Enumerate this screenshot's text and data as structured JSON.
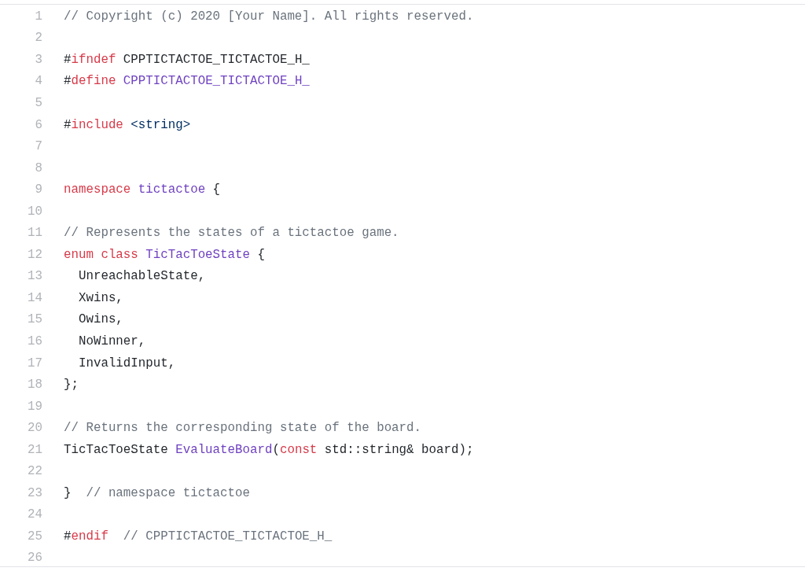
{
  "lines": [
    {
      "number": "1",
      "tokens": [
        {
          "text": "// Copyright (c) 2020 [Your Name]. All rights reserved.",
          "kind": "comment"
        }
      ]
    },
    {
      "number": "2"
    },
    {
      "number": "3",
      "tokens": [
        {
          "text": "#",
          "kind": "plain"
        },
        {
          "text": "ifndef",
          "kind": "keyword"
        },
        {
          "text": " CPPTICTACTOE_TICTACTOE_H_",
          "kind": "plain"
        }
      ]
    },
    {
      "number": "4",
      "tokens": [
        {
          "text": "#",
          "kind": "plain"
        },
        {
          "text": "define",
          "kind": "keyword"
        },
        {
          "text": " CPPTICTACTOE_TICTACTOE_H_",
          "kind": "entity"
        }
      ]
    },
    {
      "number": "5"
    },
    {
      "number": "6",
      "tokens": [
        {
          "text": "#",
          "kind": "plain"
        },
        {
          "text": "include",
          "kind": "keyword"
        },
        {
          "text": " <string>",
          "kind": "string"
        }
      ]
    },
    {
      "number": "7"
    },
    {
      "number": "8"
    },
    {
      "number": "9",
      "tokens": [
        {
          "text": "namespace",
          "kind": "keyword"
        },
        {
          "text": " tictactoe",
          "kind": "entity"
        },
        {
          "text": " {",
          "kind": "plain"
        }
      ]
    },
    {
      "number": "10"
    },
    {
      "number": "11",
      "tokens": [
        {
          "text": "// Represents the states of a tictactoe game.",
          "kind": "comment"
        }
      ]
    },
    {
      "number": "12",
      "tokens": [
        {
          "text": "enum class",
          "kind": "keyword"
        },
        {
          "text": " TicTacToeState",
          "kind": "entity"
        },
        {
          "text": " {",
          "kind": "plain"
        }
      ]
    },
    {
      "number": "13",
      "tokens": [
        {
          "text": "  UnreachableState,",
          "kind": "plain"
        }
      ]
    },
    {
      "number": "14",
      "tokens": [
        {
          "text": "  Xwins,",
          "kind": "plain"
        }
      ]
    },
    {
      "number": "15",
      "tokens": [
        {
          "text": "  Owins,",
          "kind": "plain"
        }
      ]
    },
    {
      "number": "16",
      "tokens": [
        {
          "text": "  NoWinner,",
          "kind": "plain"
        }
      ]
    },
    {
      "number": "17",
      "tokens": [
        {
          "text": "  InvalidInput,",
          "kind": "plain"
        }
      ]
    },
    {
      "number": "18",
      "tokens": [
        {
          "text": "};",
          "kind": "plain"
        }
      ]
    },
    {
      "number": "19"
    },
    {
      "number": "20",
      "tokens": [
        {
          "text": "// Returns the corresponding state of the board.",
          "kind": "comment"
        }
      ]
    },
    {
      "number": "21",
      "tokens": [
        {
          "text": "TicTacToeState ",
          "kind": "plain"
        },
        {
          "text": "EvaluateBoard",
          "kind": "entity"
        },
        {
          "text": "(",
          "kind": "plain"
        },
        {
          "text": "const",
          "kind": "keyword"
        },
        {
          "text": " std::string& board);",
          "kind": "plain"
        }
      ]
    },
    {
      "number": "22"
    },
    {
      "number": "23",
      "tokens": [
        {
          "text": "}  ",
          "kind": "plain"
        },
        {
          "text": "// namespace tictactoe",
          "kind": "comment"
        }
      ]
    },
    {
      "number": "24"
    },
    {
      "number": "25",
      "tokens": [
        {
          "text": "#",
          "kind": "plain"
        },
        {
          "text": "endif",
          "kind": "keyword"
        },
        {
          "text": "  // CPPTICTACTOE_TICTACTOE_H_",
          "kind": "comment"
        }
      ]
    },
    {
      "number": "26"
    }
  ]
}
